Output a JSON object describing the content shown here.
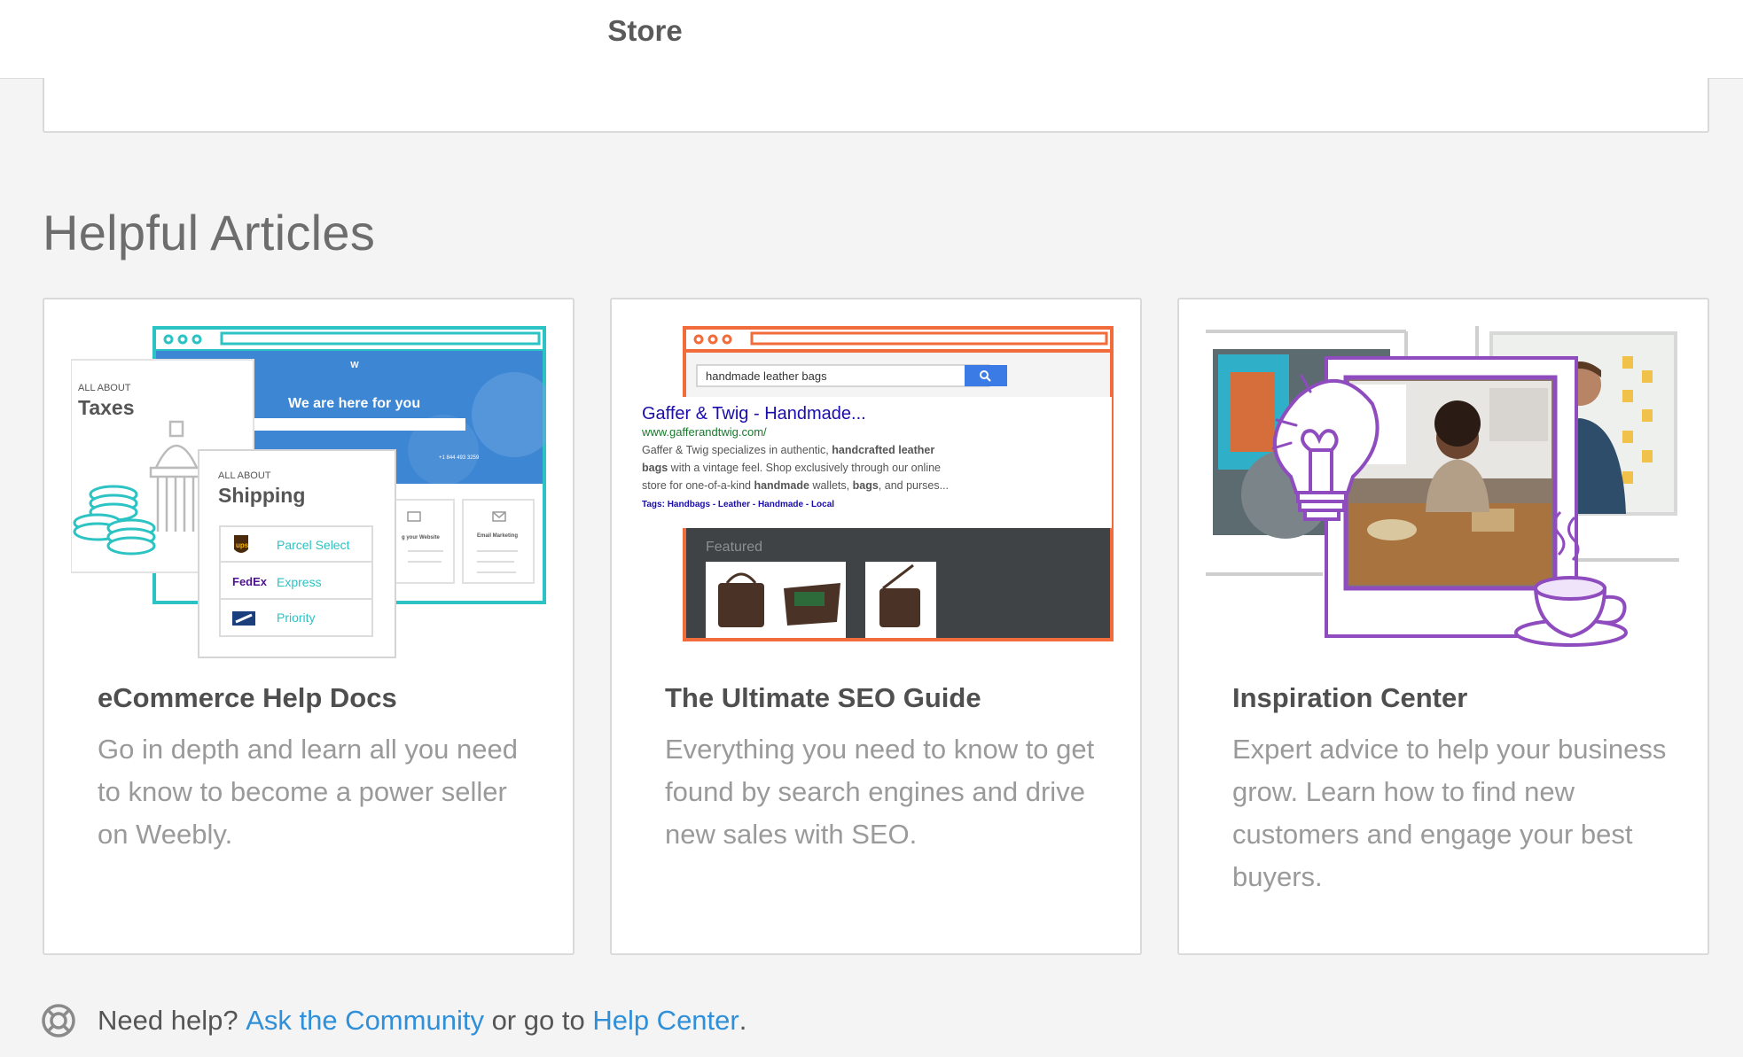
{
  "header": {
    "title": "Store"
  },
  "section": {
    "title": "Helpful Articles"
  },
  "articles": [
    {
      "title": "eCommerce Help Docs",
      "description": "Go in depth and learn all you need to know to become a power seller on Weebly.",
      "art": {
        "site_heading": "We are here for you",
        "taxes_kicker": "ALL ABOUT",
        "taxes_title": "Taxes",
        "shipping_kicker": "ALL ABOUT",
        "shipping_title": "Shipping",
        "carriers": [
          {
            "logo": "ups",
            "service": "Parcel Select"
          },
          {
            "logo": "FedEx",
            "service": "Express"
          },
          {
            "logo": "usps-eagle-icon",
            "service": "Priority"
          }
        ],
        "mini_cards": [
          "g your Website",
          "Email Marketing"
        ]
      }
    },
    {
      "title": "The Ultimate SEO Guide",
      "description": "Everything you need to know to get found by search engines and drive new sales with SEO.",
      "art": {
        "search_query": "handmade leather bags",
        "result_title": "Gaffer & Twig  - Handmade...",
        "result_url": "www.gafferandtwig.com/",
        "result_line1_a": "Gaffer & Twig specializes in authentic, ",
        "result_line1_b": "handcrafted leather",
        "result_line2_a": "bags",
        "result_line2_b": " with a vintage feel. Shop exclusively through our online",
        "result_line3_a": "store for one-of-a-kind ",
        "result_line3_b": "handmade",
        "result_line3_c": " wallets, ",
        "result_line3_d": "bags",
        "result_line3_e": ", and purses...",
        "result_tags": "Tags: Handbags  -  Leather  -  Handmade  -   Local",
        "featured_label": "Featured"
      }
    },
    {
      "title": "Inspiration Center",
      "description": "Expert advice to help your business grow. Learn how to find new customers and engage your best buyers.",
      "art": {}
    }
  ],
  "help": {
    "prefix": "Need help? ",
    "community_link": "Ask the Community",
    "middle": " or go to ",
    "center_link": "Help Center",
    "suffix": "."
  },
  "colors": {
    "link": "#2f8fd9",
    "teal": "#2bc3c3",
    "orange": "#f26b3a",
    "purple": "#8e4cbf"
  }
}
